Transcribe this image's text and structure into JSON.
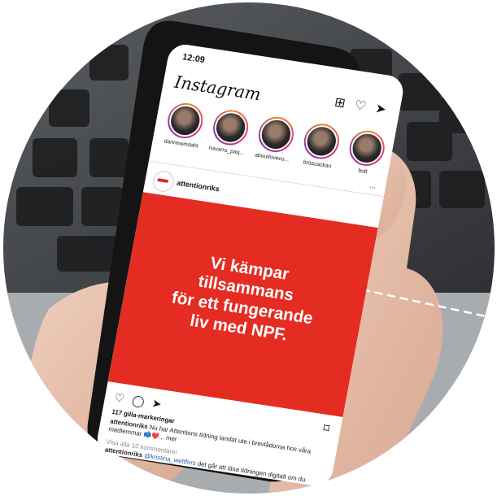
{
  "status_time": "12:09",
  "app_name": "Instagram",
  "top_icons": [
    "add-post-icon",
    "heart-icon",
    "send-icon"
  ],
  "stories": [
    {
      "name": "dannewindahl"
    },
    {
      "name": "navarro_paq..."
    },
    {
      "name": "aboutloveco..."
    },
    {
      "name": "britazackari"
    },
    {
      "name": "bolt"
    }
  ],
  "more_label": "...",
  "post_account": "attentionriks",
  "post_text": "Vi kämpar tillsammans för ett fungerande liv med NPF.",
  "post_text_lines": [
    "Vi kämpar",
    "tillsammans",
    "för ett fungerande",
    "liv med NPF."
  ],
  "likes": "117 gilla-markeringar",
  "caption_user": "attentionriks",
  "caption_text": "Nu har Attentions tidning landat ute i brevlådorna hos våra medlemmar 📫❤️... mer",
  "view_comments": "Visa alla 10 kommentarer",
  "comment_user": "attentionriks",
  "comment_mention": "@kristina_wettfors",
  "comment_text": "det går att läsa tidningen digitalt om du loggar in som medlem på",
  "colors": {
    "accent": "#e42c22",
    "text": "#111111",
    "background": "#ffffff"
  }
}
